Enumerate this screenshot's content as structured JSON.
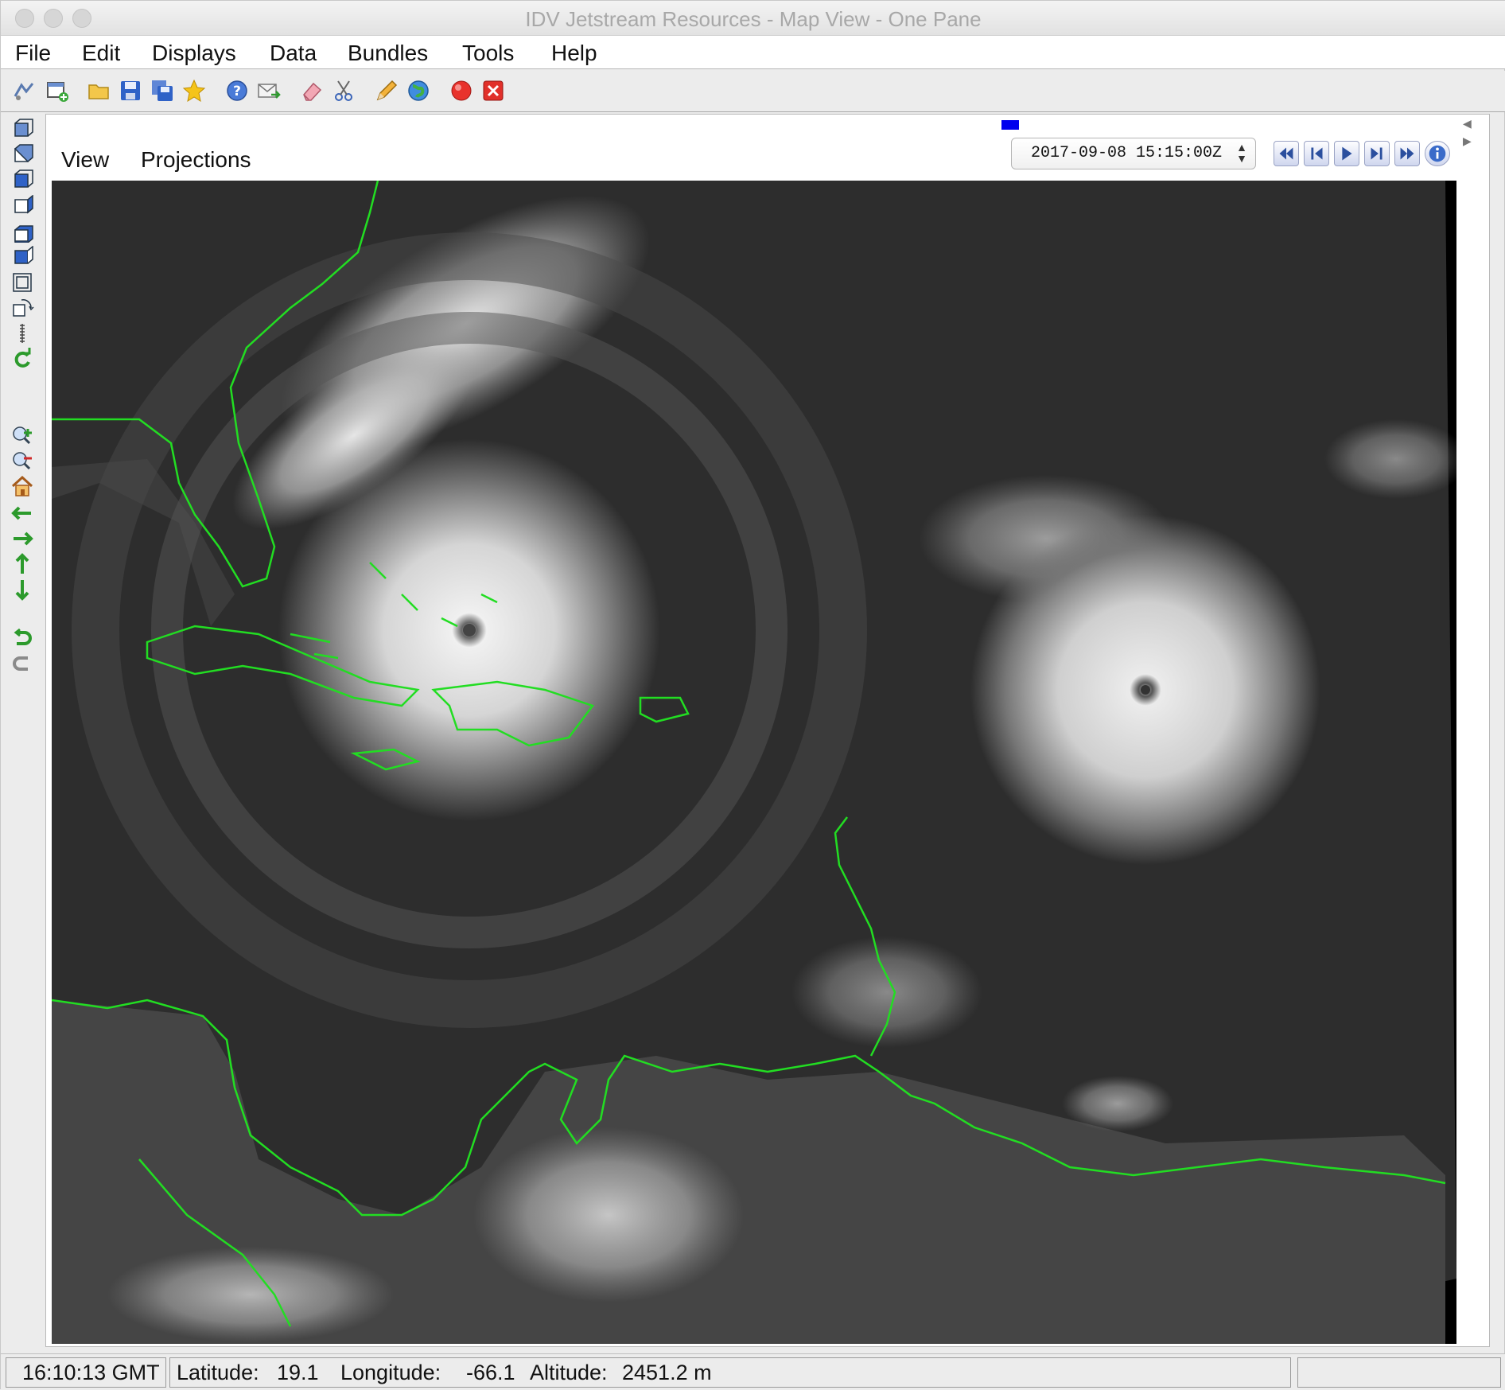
{
  "window": {
    "title": "IDV Jetstream Resources - Map View - One Pane"
  },
  "menubar": {
    "items": [
      "File",
      "Edit",
      "Displays",
      "Data",
      "Bundles",
      "Tools",
      "Help"
    ]
  },
  "toolbar": {
    "icons": [
      "data-source-icon",
      "new-window-icon",
      "open-folder-icon",
      "save-icon",
      "save-as-icon",
      "favorite-star-icon",
      "help-icon",
      "mail-icon",
      "eraser-icon",
      "cut-icon",
      "pencil-icon",
      "globe-icon",
      "record-icon",
      "close-icon"
    ]
  },
  "view_menu": {
    "items": [
      "View",
      "Projections"
    ]
  },
  "animation": {
    "time": "2017-09-08 15:15:00Z"
  },
  "status": {
    "time": "16:10:13 GMT",
    "latitude_label": "Latitude:",
    "latitude": "19.1",
    "longitude_label": "Longitude:",
    "longitude": "-66.1",
    "altitude_label": "Altitude:",
    "altitude": "2451.2 m"
  },
  "colors": {
    "coastline": "#22dd22",
    "marker": "#0000ee",
    "record": "#e8322c"
  }
}
